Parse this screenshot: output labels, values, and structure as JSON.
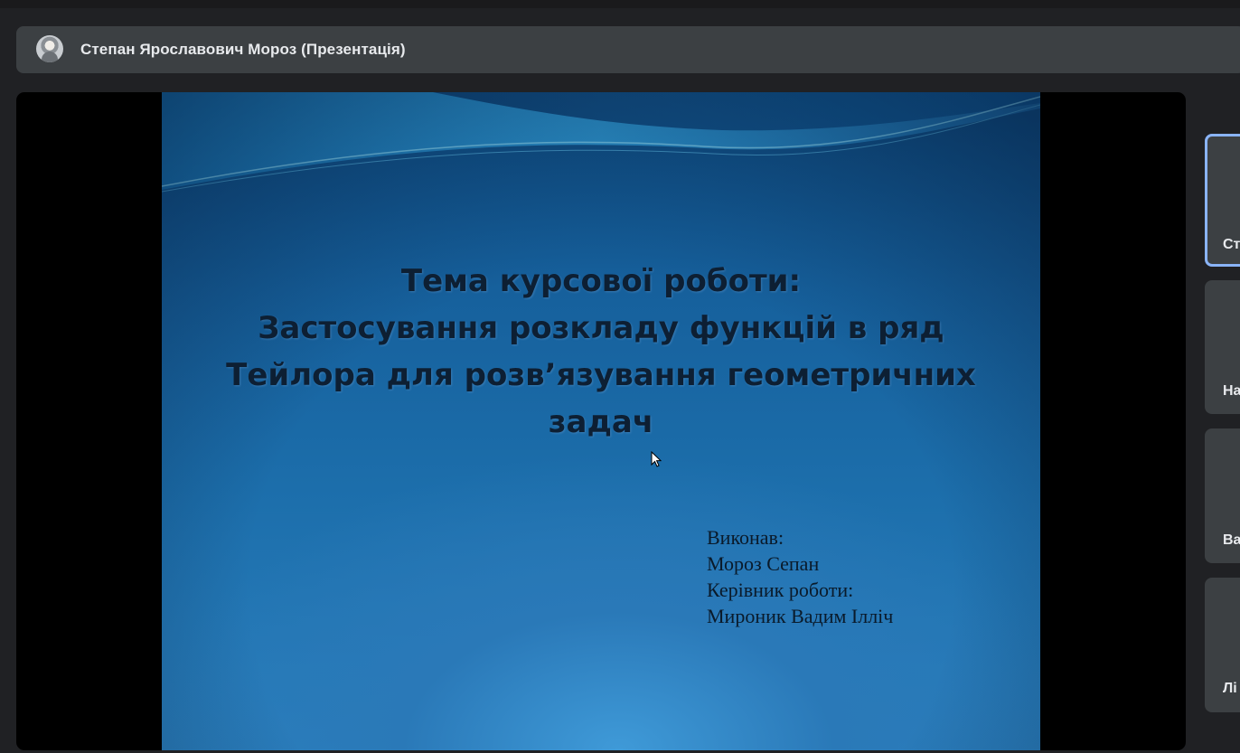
{
  "presenter": {
    "name": "Степан Ярославович Мороз (Презентація)"
  },
  "slide": {
    "title_lines": [
      "Тема курсової роботи:",
      "Застосування розкладу функцій в ряд",
      "Тейлора для розв’язування геометричних",
      "задач"
    ],
    "credits": [
      "Виконав:",
      "Мороз Сепан",
      "Керівник роботи:",
      "Мироник Вадим Ілліч"
    ]
  },
  "participants": [
    {
      "label": "Ст",
      "active": true
    },
    {
      "label": "На",
      "active": false
    },
    {
      "label": "Ва",
      "active": false
    },
    {
      "label": "Лі",
      "active": false
    }
  ],
  "colors": {
    "background": "#202124",
    "bar": "#3c4043",
    "active_border": "#8ab4f8"
  }
}
